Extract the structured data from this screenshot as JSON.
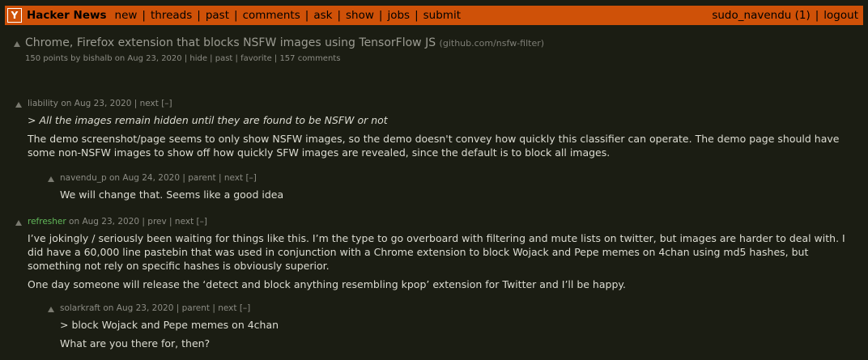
{
  "header": {
    "logo_letter": "Y",
    "site_name": "Hacker News",
    "nav": [
      "new",
      "threads",
      "past",
      "comments",
      "ask",
      "show",
      "jobs",
      "submit"
    ],
    "user": "sudo_navendu (1)",
    "logout": "logout",
    "separator": "|",
    "accent_color": "#cf5108"
  },
  "story": {
    "title": "Chrome, Firefox extension that blocks NSFW images using TensorFlow JS",
    "site": "(github.com/nsfw-filter)",
    "points": "150 points",
    "by": "by",
    "author": "bishalb",
    "on": "on",
    "time": "Aug 23, 2020",
    "links": "| hide | past | favorite | 157 comments"
  },
  "comments": [
    {
      "user": "liability",
      "time": "on Aug 23, 2020",
      "links": "| next [–]",
      "quote": "> All the images remain hidden until they are found to be NSFW or not",
      "text": "The demo screenshot/page seems to only show NSFW images, so the demo doesn't convey how quickly this classifier can operate. The demo page should have some non-NSFW images to show off how quickly SFW images are revealed, since the default is to block all images."
    },
    {
      "user": "navendu_p",
      "time": "on Aug 24, 2020",
      "links": "| parent | next [–]",
      "text": "We will change that. Seems like a good idea"
    },
    {
      "user": "refresher",
      "time": "on Aug 23, 2020",
      "links": "| prev | next [–]",
      "text": "I’ve jokingly / seriously been waiting for things like this. I’m the type to go overboard with filtering and mute lists on twitter, but images are harder to deal with. I did have a 60,000 line pastebin that was used in conjunction with a Chrome extension to block Wojack and Pepe memes on 4chan using md5 hashes, but something not rely on specific hashes is obviously superior.",
      "text2": "One day someone will release the ‘detect and block anything resembling kpop’ extension for Twitter and I’ll be happy."
    },
    {
      "user": "solarkraft",
      "time": "on Aug 23, 2020",
      "links": "| parent | next [–]",
      "quote": "> block Wojack and Pepe memes on 4chan",
      "text": "What are you there for, then?"
    }
  ]
}
